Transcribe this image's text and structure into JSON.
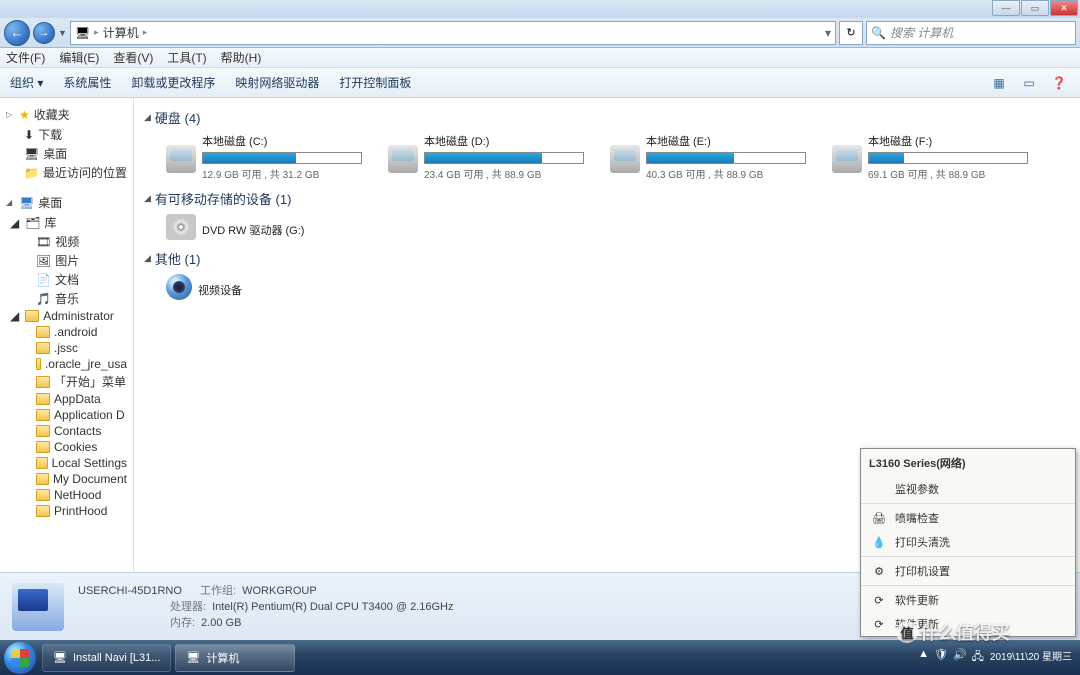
{
  "window_controls": {
    "min": "—",
    "max": "▭",
    "close": "✕"
  },
  "address": {
    "location": "计算机",
    "refresh": "↻",
    "dropdown": "▾"
  },
  "search": {
    "placeholder": "搜索 计算机",
    "icon": "🔍"
  },
  "menubar": [
    "文件(F)",
    "编辑(E)",
    "查看(V)",
    "工具(T)",
    "帮助(H)"
  ],
  "toolbar": {
    "items": [
      "组织 ▾",
      "系统属性",
      "卸载或更改程序",
      "映射网络驱动器",
      "打开控制面板"
    ],
    "right_icons": [
      "▦",
      "▭",
      "❓"
    ]
  },
  "sidebar": {
    "favorites": {
      "label": "收藏夹",
      "items": [
        "下载",
        "桌面",
        "最近访问的位置"
      ]
    },
    "desktop": {
      "label": "桌面",
      "library": {
        "label": "库",
        "items": [
          "视频",
          "图片",
          "文档",
          "音乐"
        ]
      },
      "user": {
        "label": "Administrator",
        "items": [
          ".android",
          ".jssc",
          ".oracle_jre_usa",
          "「开始」菜单",
          "AppData",
          "Application D",
          "Contacts",
          "Cookies",
          "Local Settings",
          "My Document",
          "NetHood",
          "PrintHood"
        ]
      }
    }
  },
  "content": {
    "hdd": {
      "label": "硬盘 (4)",
      "drives": [
        {
          "name": "本地磁盘 (C:)",
          "free": "12.9 GB 可用 , 共 31.2 GB",
          "pct": 59
        },
        {
          "name": "本地磁盘 (D:)",
          "free": "23.4 GB 可用 , 共 88.9 GB",
          "pct": 74
        },
        {
          "name": "本地磁盘 (E:)",
          "free": "40.3 GB 可用 , 共 88.9 GB",
          "pct": 55
        },
        {
          "name": "本地磁盘 (F:)",
          "free": "69.1 GB 可用 , 共 88.9 GB",
          "pct": 22
        }
      ]
    },
    "removable": {
      "label": "有可移动存储的设备 (1)",
      "item": "DVD RW 驱动器 (G:)"
    },
    "other": {
      "label": "其他 (1)",
      "item": "视频设备"
    }
  },
  "details": {
    "computer": "USERCHI-45D1RNO",
    "workgroup_lbl": "工作组:",
    "workgroup": "WORKGROUP",
    "cpu_lbl": "处理器:",
    "cpu": "Intel(R) Pentium(R) Dual  CPU  T3400  @ 2.16GHz",
    "mem_lbl": "内存:",
    "mem": "2.00 GB"
  },
  "popup": {
    "title": "L3160 Series(网络)",
    "items": [
      "监视参数",
      "喷嘴检查",
      "打印头清洗",
      "打印机设置",
      "软件更新",
      "软件更新"
    ]
  },
  "taskbar": {
    "items": [
      {
        "label": "Install Navi [L31..."
      },
      {
        "label": "计算机"
      }
    ],
    "clock_time": "",
    "clock_date": "2019\\11\\20 星期三"
  },
  "watermark": "什么值得买"
}
